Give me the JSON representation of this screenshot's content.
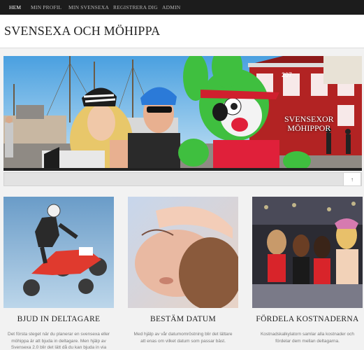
{
  "nav": {
    "items": [
      {
        "label": "HEM",
        "active": true
      },
      {
        "label": "MIN PROFIL",
        "active": false
      },
      {
        "label": "MIN SVENSEXA",
        "active": false
      },
      {
        "label": "REGISTRERA DIG",
        "active": false
      },
      {
        "label": "ADMIN",
        "active": false
      }
    ]
  },
  "header": {
    "title": "SVENSEXA OCH MÖHIPPA"
  },
  "banner": {
    "caption_line1": "SVENSEXOR",
    "caption_line2": "MÖHIPPOR",
    "building_number": "207",
    "slider_icon": "arrow-up-icon",
    "slider_glyph": "↑"
  },
  "features": [
    {
      "title": "BJUD IN DELTAGARE",
      "text_line1": "Det första steget när du planerar en svensexa eller",
      "text_line2": "möhippa är att bjuda in deltagare. Men hjälp av",
      "text_line3": "Svensexa 2.0 blir det lätt då du kan bjuda in via"
    },
    {
      "title": "BESTÄM DATUM",
      "text_line1": "Med hjälp av vår datumomröstning blir det lättare",
      "text_line2": "att enas om vilket datum som passar bäst.",
      "text_line3": ""
    },
    {
      "title": "FÖRDELA KOSTNADERNA",
      "text_line1": "Kostnadskalkylatorn samlar alla kostnader och",
      "text_line2": "fördelar dem mellan deltagarna.",
      "text_line3": ""
    }
  ],
  "colors": {
    "nav_bg": "#1c1c1c",
    "page_bg": "#f2f2f2",
    "building_red": "#b22323",
    "bunny_green": "#3fbf3f"
  }
}
